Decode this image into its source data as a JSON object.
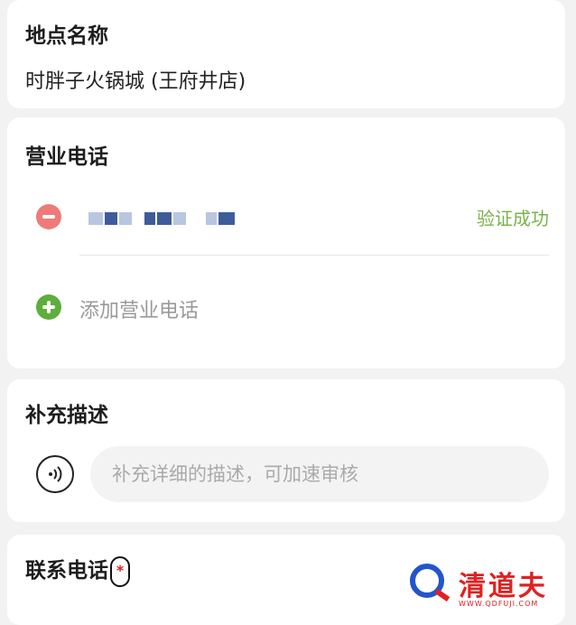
{
  "place_name": {
    "title": "地点名称",
    "value": "时胖子火锅城 (王府井店)"
  },
  "business_phone": {
    "title": "营业电话",
    "phone_masked": true,
    "status": "验证成功",
    "add_label": "添加营业电话",
    "colors": {
      "remove": "#ee7a7a",
      "add": "#5dae3a",
      "status": "#7ab24a"
    }
  },
  "description": {
    "title": "补充描述",
    "placeholder": "补充详细的描述，可加速审核",
    "voice_icon": "voice-wave-icon"
  },
  "contact_phone": {
    "title": "联系电话",
    "required_mark": "*"
  },
  "watermark": {
    "text": "清道夫",
    "sub": "WWW.QDFUJI.COM"
  }
}
